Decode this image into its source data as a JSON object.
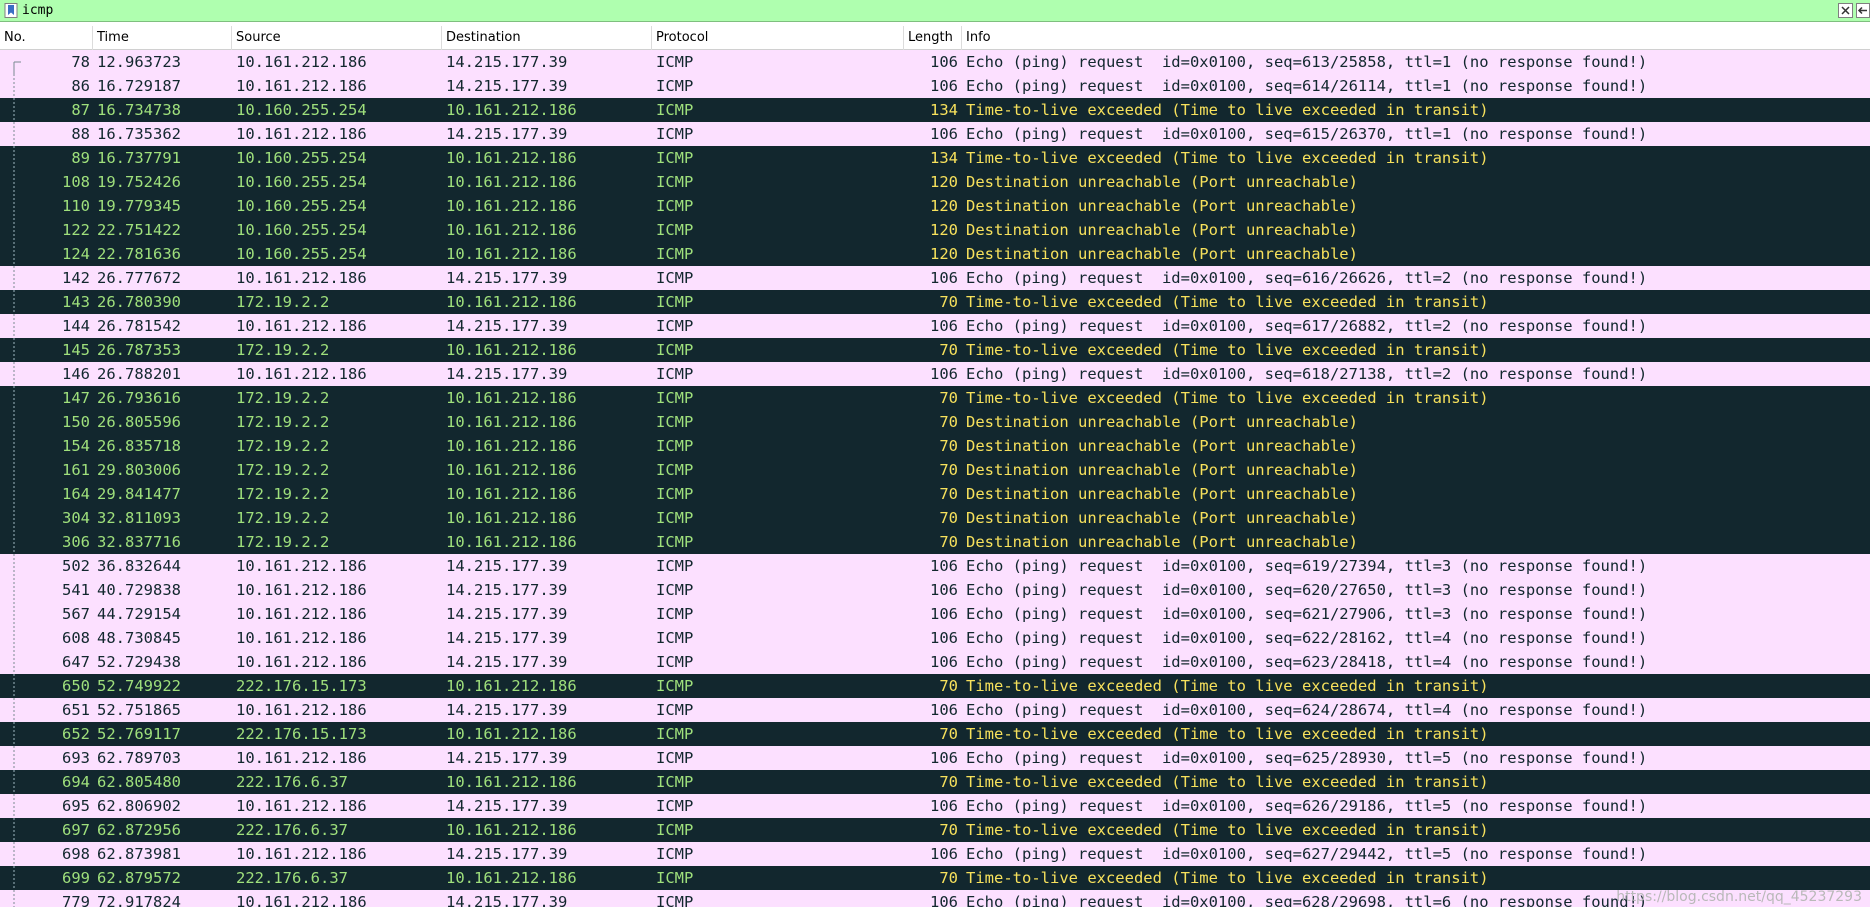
{
  "filter": {
    "value": "icmp",
    "placeholder": ""
  },
  "columns": [
    "No.",
    "Time",
    "Source",
    "Destination",
    "Protocol",
    "Length",
    "Info"
  ],
  "packets": [
    {
      "no": "78",
      "time": "12.963723",
      "src": "10.161.212.186",
      "dst": "14.215.177.39",
      "proto": "ICMP",
      "len": "106",
      "info": "Echo (ping) request  id=0x0100, seq=613/25858, ttl=1 (no response found!)",
      "kind": "echo"
    },
    {
      "no": "86",
      "time": "16.729187",
      "src": "10.161.212.186",
      "dst": "14.215.177.39",
      "proto": "ICMP",
      "len": "106",
      "info": "Echo (ping) request  id=0x0100, seq=614/26114, ttl=1 (no response found!)",
      "kind": "echo"
    },
    {
      "no": "87",
      "time": "16.734738",
      "src": "10.160.255.254",
      "dst": "10.161.212.186",
      "proto": "ICMP",
      "len": "134",
      "info": "Time-to-live exceeded (Time to live exceeded in transit)",
      "kind": "err"
    },
    {
      "no": "88",
      "time": "16.735362",
      "src": "10.161.212.186",
      "dst": "14.215.177.39",
      "proto": "ICMP",
      "len": "106",
      "info": "Echo (ping) request  id=0x0100, seq=615/26370, ttl=1 (no response found!)",
      "kind": "echo"
    },
    {
      "no": "89",
      "time": "16.737791",
      "src": "10.160.255.254",
      "dst": "10.161.212.186",
      "proto": "ICMP",
      "len": "134",
      "info": "Time-to-live exceeded (Time to live exceeded in transit)",
      "kind": "err"
    },
    {
      "no": "108",
      "time": "19.752426",
      "src": "10.160.255.254",
      "dst": "10.161.212.186",
      "proto": "ICMP",
      "len": "120",
      "info": "Destination unreachable (Port unreachable)",
      "kind": "err"
    },
    {
      "no": "110",
      "time": "19.779345",
      "src": "10.160.255.254",
      "dst": "10.161.212.186",
      "proto": "ICMP",
      "len": "120",
      "info": "Destination unreachable (Port unreachable)",
      "kind": "err"
    },
    {
      "no": "122",
      "time": "22.751422",
      "src": "10.160.255.254",
      "dst": "10.161.212.186",
      "proto": "ICMP",
      "len": "120",
      "info": "Destination unreachable (Port unreachable)",
      "kind": "err"
    },
    {
      "no": "124",
      "time": "22.781636",
      "src": "10.160.255.254",
      "dst": "10.161.212.186",
      "proto": "ICMP",
      "len": "120",
      "info": "Destination unreachable (Port unreachable)",
      "kind": "err"
    },
    {
      "no": "142",
      "time": "26.777672",
      "src": "10.161.212.186",
      "dst": "14.215.177.39",
      "proto": "ICMP",
      "len": "106",
      "info": "Echo (ping) request  id=0x0100, seq=616/26626, ttl=2 (no response found!)",
      "kind": "echo"
    },
    {
      "no": "143",
      "time": "26.780390",
      "src": "172.19.2.2",
      "dst": "10.161.212.186",
      "proto": "ICMP",
      "len": "70",
      "info": "Time-to-live exceeded (Time to live exceeded in transit)",
      "kind": "err"
    },
    {
      "no": "144",
      "time": "26.781542",
      "src": "10.161.212.186",
      "dst": "14.215.177.39",
      "proto": "ICMP",
      "len": "106",
      "info": "Echo (ping) request  id=0x0100, seq=617/26882, ttl=2 (no response found!)",
      "kind": "echo"
    },
    {
      "no": "145",
      "time": "26.787353",
      "src": "172.19.2.2",
      "dst": "10.161.212.186",
      "proto": "ICMP",
      "len": "70",
      "info": "Time-to-live exceeded (Time to live exceeded in transit)",
      "kind": "err"
    },
    {
      "no": "146",
      "time": "26.788201",
      "src": "10.161.212.186",
      "dst": "14.215.177.39",
      "proto": "ICMP",
      "len": "106",
      "info": "Echo (ping) request  id=0x0100, seq=618/27138, ttl=2 (no response found!)",
      "kind": "echo"
    },
    {
      "no": "147",
      "time": "26.793616",
      "src": "172.19.2.2",
      "dst": "10.161.212.186",
      "proto": "ICMP",
      "len": "70",
      "info": "Time-to-live exceeded (Time to live exceeded in transit)",
      "kind": "err"
    },
    {
      "no": "150",
      "time": "26.805596",
      "src": "172.19.2.2",
      "dst": "10.161.212.186",
      "proto": "ICMP",
      "len": "70",
      "info": "Destination unreachable (Port unreachable)",
      "kind": "err"
    },
    {
      "no": "154",
      "time": "26.835718",
      "src": "172.19.2.2",
      "dst": "10.161.212.186",
      "proto": "ICMP",
      "len": "70",
      "info": "Destination unreachable (Port unreachable)",
      "kind": "err"
    },
    {
      "no": "161",
      "time": "29.803006",
      "src": "172.19.2.2",
      "dst": "10.161.212.186",
      "proto": "ICMP",
      "len": "70",
      "info": "Destination unreachable (Port unreachable)",
      "kind": "err"
    },
    {
      "no": "164",
      "time": "29.841477",
      "src": "172.19.2.2",
      "dst": "10.161.212.186",
      "proto": "ICMP",
      "len": "70",
      "info": "Destination unreachable (Port unreachable)",
      "kind": "err"
    },
    {
      "no": "304",
      "time": "32.811093",
      "src": "172.19.2.2",
      "dst": "10.161.212.186",
      "proto": "ICMP",
      "len": "70",
      "info": "Destination unreachable (Port unreachable)",
      "kind": "err"
    },
    {
      "no": "306",
      "time": "32.837716",
      "src": "172.19.2.2",
      "dst": "10.161.212.186",
      "proto": "ICMP",
      "len": "70",
      "info": "Destination unreachable (Port unreachable)",
      "kind": "err"
    },
    {
      "no": "502",
      "time": "36.832644",
      "src": "10.161.212.186",
      "dst": "14.215.177.39",
      "proto": "ICMP",
      "len": "106",
      "info": "Echo (ping) request  id=0x0100, seq=619/27394, ttl=3 (no response found!)",
      "kind": "echo"
    },
    {
      "no": "541",
      "time": "40.729838",
      "src": "10.161.212.186",
      "dst": "14.215.177.39",
      "proto": "ICMP",
      "len": "106",
      "info": "Echo (ping) request  id=0x0100, seq=620/27650, ttl=3 (no response found!)",
      "kind": "echo"
    },
    {
      "no": "567",
      "time": "44.729154",
      "src": "10.161.212.186",
      "dst": "14.215.177.39",
      "proto": "ICMP",
      "len": "106",
      "info": "Echo (ping) request  id=0x0100, seq=621/27906, ttl=3 (no response found!)",
      "kind": "echo"
    },
    {
      "no": "608",
      "time": "48.730845",
      "src": "10.161.212.186",
      "dst": "14.215.177.39",
      "proto": "ICMP",
      "len": "106",
      "info": "Echo (ping) request  id=0x0100, seq=622/28162, ttl=4 (no response found!)",
      "kind": "echo"
    },
    {
      "no": "647",
      "time": "52.729438",
      "src": "10.161.212.186",
      "dst": "14.215.177.39",
      "proto": "ICMP",
      "len": "106",
      "info": "Echo (ping) request  id=0x0100, seq=623/28418, ttl=4 (no response found!)",
      "kind": "echo"
    },
    {
      "no": "650",
      "time": "52.749922",
      "src": "222.176.15.173",
      "dst": "10.161.212.186",
      "proto": "ICMP",
      "len": "70",
      "info": "Time-to-live exceeded (Time to live exceeded in transit)",
      "kind": "err"
    },
    {
      "no": "651",
      "time": "52.751865",
      "src": "10.161.212.186",
      "dst": "14.215.177.39",
      "proto": "ICMP",
      "len": "106",
      "info": "Echo (ping) request  id=0x0100, seq=624/28674, ttl=4 (no response found!)",
      "kind": "echo"
    },
    {
      "no": "652",
      "time": "52.769117",
      "src": "222.176.15.173",
      "dst": "10.161.212.186",
      "proto": "ICMP",
      "len": "70",
      "info": "Time-to-live exceeded (Time to live exceeded in transit)",
      "kind": "err"
    },
    {
      "no": "693",
      "time": "62.789703",
      "src": "10.161.212.186",
      "dst": "14.215.177.39",
      "proto": "ICMP",
      "len": "106",
      "info": "Echo (ping) request  id=0x0100, seq=625/28930, ttl=5 (no response found!)",
      "kind": "echo"
    },
    {
      "no": "694",
      "time": "62.805480",
      "src": "222.176.6.37",
      "dst": "10.161.212.186",
      "proto": "ICMP",
      "len": "70",
      "info": "Time-to-live exceeded (Time to live exceeded in transit)",
      "kind": "err"
    },
    {
      "no": "695",
      "time": "62.806902",
      "src": "10.161.212.186",
      "dst": "14.215.177.39",
      "proto": "ICMP",
      "len": "106",
      "info": "Echo (ping) request  id=0x0100, seq=626/29186, ttl=5 (no response found!)",
      "kind": "echo"
    },
    {
      "no": "697",
      "time": "62.872956",
      "src": "222.176.6.37",
      "dst": "10.161.212.186",
      "proto": "ICMP",
      "len": "70",
      "info": "Time-to-live exceeded (Time to live exceeded in transit)",
      "kind": "err"
    },
    {
      "no": "698",
      "time": "62.873981",
      "src": "10.161.212.186",
      "dst": "14.215.177.39",
      "proto": "ICMP",
      "len": "106",
      "info": "Echo (ping) request  id=0x0100, seq=627/29442, ttl=5 (no response found!)",
      "kind": "echo"
    },
    {
      "no": "699",
      "time": "62.879572",
      "src": "222.176.6.37",
      "dst": "10.161.212.186",
      "proto": "ICMP",
      "len": "70",
      "info": "Time-to-live exceeded (Time to live exceeded in transit)",
      "kind": "err"
    },
    {
      "no": "779",
      "time": "72.917824",
      "src": "10.161.212.186",
      "dst": "14.215.177.39",
      "proto": "ICMP",
      "len": "106",
      "info": "Echo (ping) request  id=0x0100, seq=628/29698, ttl=6 (no response found!)",
      "kind": "echo"
    }
  ],
  "watermark": "https://blog.csdn.net/qq_45237293",
  "colors": {
    "filter_bg": "#afffaf",
    "echo_bg": "#fce0ff",
    "error_bg": "#12272e",
    "error_fg": "#f7e15c",
    "accent": "#3a6fc4"
  }
}
